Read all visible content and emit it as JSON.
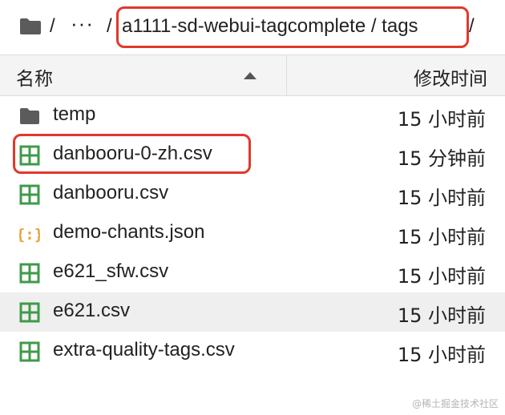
{
  "breadcrumb": {
    "sep": "/",
    "ellipsis": "···",
    "path": "a1111-sd-webui-tagcomplete / tags",
    "trailing_sep": "/"
  },
  "header": {
    "name_label": "名称",
    "time_label": "修改时间",
    "sort_direction": "ascending"
  },
  "files": [
    {
      "name": "temp",
      "time": "15 小时前",
      "icon": "folder-icon"
    },
    {
      "name": "danbooru-0-zh.csv",
      "time": "15 分钟前",
      "icon": "csv-grid-icon"
    },
    {
      "name": "danbooru.csv",
      "time": "15 小时前",
      "icon": "csv-grid-icon"
    },
    {
      "name": "demo-chants.json",
      "time": "15 小时前",
      "icon": "json-braces-icon"
    },
    {
      "name": "e621_sfw.csv",
      "time": "15 小时前",
      "icon": "csv-grid-icon"
    },
    {
      "name": "e621.csv",
      "time": "15 小时前",
      "icon": "csv-grid-icon",
      "selected": true
    },
    {
      "name": "extra-quality-tags.csv",
      "time": "15 小时前",
      "icon": "csv-grid-icon"
    }
  ],
  "colors": {
    "highlight": "#e0392b",
    "csv_icon": "#3f9a4a",
    "json_icon": "#e8a33d",
    "folder": "#5b5b5b"
  },
  "watermark": "@稀土掘金技术社区"
}
